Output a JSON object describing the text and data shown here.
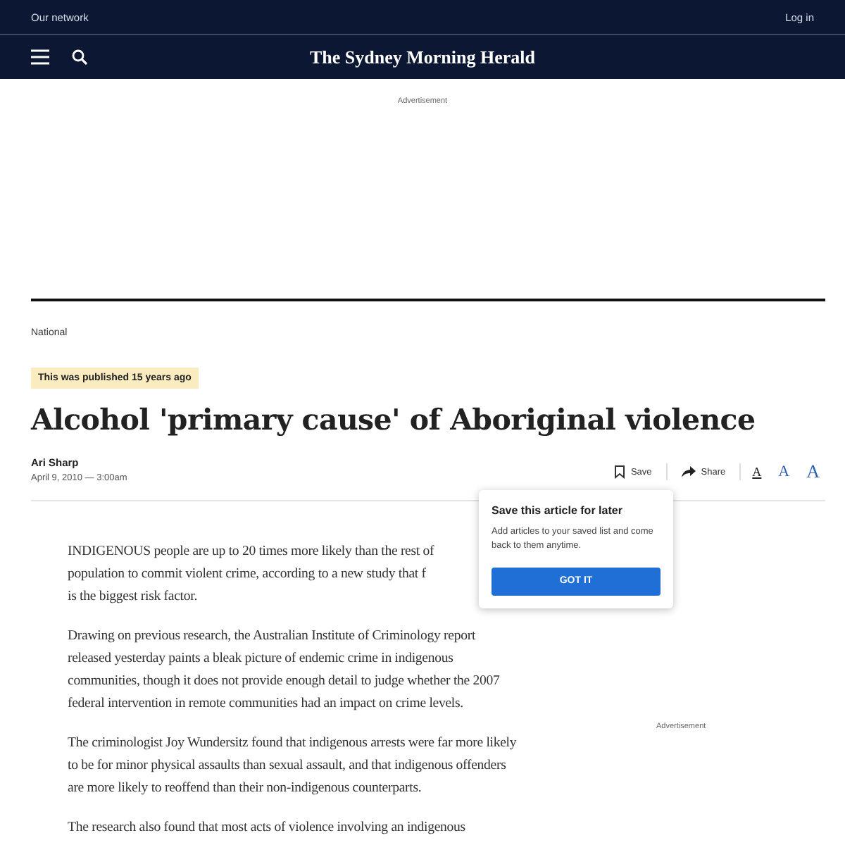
{
  "top_bar": {
    "network_link": "Our network",
    "login_link": "Log in"
  },
  "masthead": {
    "logo": "The Sydney Morning Herald"
  },
  "top_ad": {
    "label": "Advertisement"
  },
  "article": {
    "section": "National",
    "age_badge": "This was published 15 years ago",
    "headline": "Alcohol 'primary cause' of Aboriginal violence",
    "author": "Ari Sharp",
    "date": "April 9, 2010 — 3:00am",
    "actions": {
      "save": "Save",
      "share": "Share",
      "text_sizes": [
        {
          "label": "A",
          "selected": true
        },
        {
          "label": "A",
          "selected": false
        },
        {
          "label": "A",
          "selected": false
        }
      ]
    },
    "first_paragraph_lines": [
      "INDIGENOUS people are up to 20 times more likely than the rest of",
      "population to commit violent crime, according to a new study that f",
      "is the biggest risk factor."
    ],
    "paragraphs": [
      "Drawing on previous research, the Australian Institute of Criminology report released yesterday paints a bleak picture of endemic crime in indigenous communities, though it does not provide enough detail to judge whether the 2007 federal intervention in remote communities had an impact on crime levels.",
      "The criminologist Joy Wundersitz found that indigenous arrests were far more likely to be for minor physical assaults than sexual assault, and that indigenous offenders are more likely to reoffend than their non-indigenous counterparts.",
      "The research also found that most acts of violence involving an indigenous"
    ]
  },
  "side_ad": {
    "label": "Advertisement"
  },
  "save_popup": {
    "title": "Save this article for later",
    "text": "Add articles to your saved list and come back to them anytime.",
    "button": "GOT IT"
  }
}
